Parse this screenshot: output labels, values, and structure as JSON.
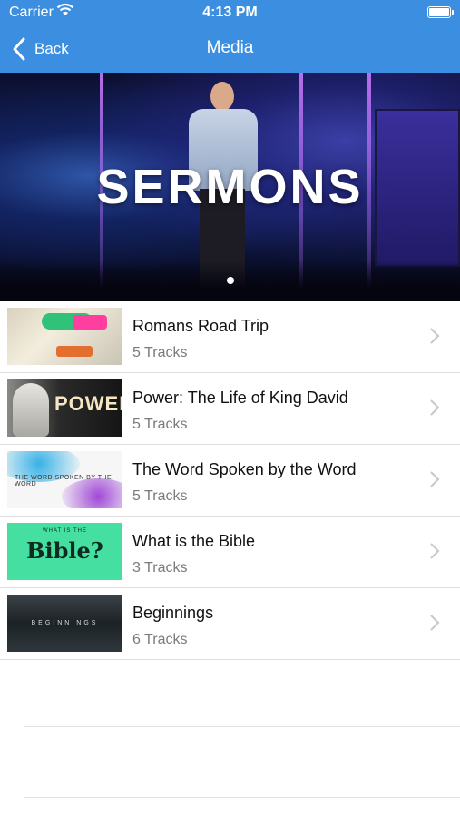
{
  "status_bar": {
    "carrier": "Carrier",
    "time": "4:13 PM"
  },
  "nav": {
    "back_label": "Back",
    "title": "Media"
  },
  "hero": {
    "title": "SERMONS"
  },
  "thumbnail_text": {
    "power": "POWER",
    "word_spoken": "THE WORD SPOKEN BY THE WORD",
    "bible_small": "WHAT IS THE",
    "bible": "Bible?",
    "beginnings": "BEGINNINGS"
  },
  "series": [
    {
      "title": "Romans Road Trip",
      "tracks": "5 Tracks"
    },
    {
      "title": "Power: The Life of King David",
      "tracks": "5 Tracks"
    },
    {
      "title": "The Word Spoken by the Word",
      "tracks": "5 Tracks"
    },
    {
      "title": "What is the Bible",
      "tracks": "3 Tracks"
    },
    {
      "title": "Beginnings",
      "tracks": "6 Tracks"
    }
  ],
  "colors": {
    "nav_bar": "#3b8ee0",
    "separator": "#dedede",
    "subtitle": "#7a7a7a"
  }
}
